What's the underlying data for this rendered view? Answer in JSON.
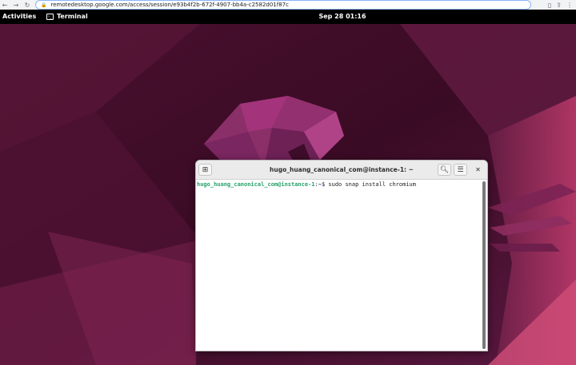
{
  "browser": {
    "back_icon": "arrow-left-icon",
    "forward_icon": "arrow-right-icon",
    "reload_icon": "reload-icon",
    "url": "remotedesktop.google.com/access/session/e93b4f2b-672f-4907-bb4a-c2582d01f87c"
  },
  "panel": {
    "activities": "Activities",
    "app_name": "Terminal",
    "clock": "Sep 28  01:16"
  },
  "terminal": {
    "title": "hugo_huang_canonical_com@instance-1: ~",
    "prompt_user": "hugo_huang_canonical_com@instance-1",
    "prompt_sep": ":",
    "prompt_path": "~",
    "prompt_symbol": "$ ",
    "command": "sudo snap install chromium"
  },
  "colors": {
    "wallpaper_dark": "#3a0b24",
    "wallpaper_mid": "#6b1c48",
    "accent_magenta": "#a3337a",
    "prompt_green": "#26a269",
    "prompt_blue": "#12488b"
  }
}
